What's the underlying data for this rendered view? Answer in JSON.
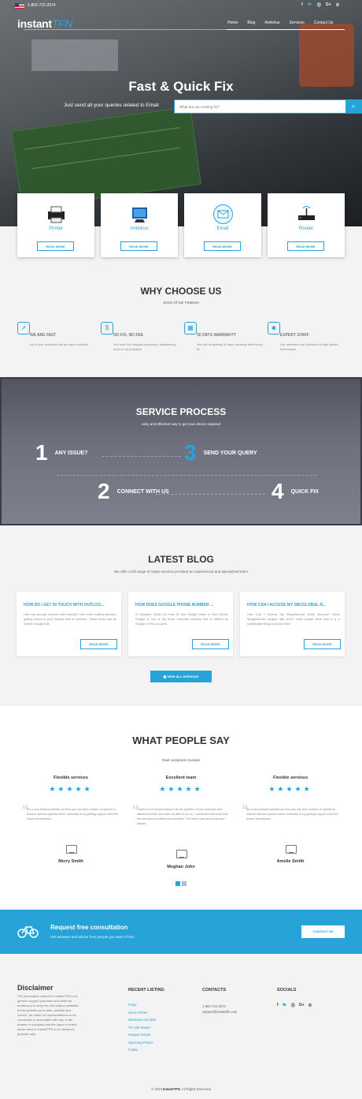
{
  "topbar": {
    "phone": "1-802-722-2574",
    "socials": [
      "f",
      "🐦",
      "⓪",
      "G+",
      "◎"
    ]
  },
  "header": {
    "logo_main": "instant",
    "logo_accent": "TFN",
    "nav": [
      "Home",
      "Blog",
      "Antivirus",
      "Services",
      "Contact Us"
    ]
  },
  "hero": {
    "title": "Fast & Quick Fix",
    "subtitle": "Just send all your queries related to Email",
    "search_placeholder": "What are you looking for?"
  },
  "services": [
    {
      "label": "Printer",
      "button": "READ MORE",
      "icon": "printer-icon"
    },
    {
      "label": "Antivirus",
      "button": "READ MORE",
      "icon": "antivirus-icon"
    },
    {
      "label": "Email",
      "button": "READ MORE",
      "icon": "email-icon"
    },
    {
      "label": "Router",
      "button": "READ MORE",
      "icon": "router-icon"
    }
  ],
  "why": {
    "title": "WHY CHOOSE US",
    "subtitle": "Some Of Our Features",
    "features": [
      {
        "title": "WE ARE FAST",
        "desc": "All of your problems will get quick solution",
        "icon": "rocket-icon"
      },
      {
        "title": "NO FIX, NO FEE",
        "desc": "You won't be charged anything if adiadanhog work is not provided",
        "icon": "dollar-icon"
      },
      {
        "title": "30 DAYS WARRANTY",
        "desc": "You will be getting 30 days warranty after every fix",
        "icon": "calendar-icon"
      },
      {
        "title": "EXPERT STAFF",
        "desc": "Our members are followed by high skilled technicians",
        "icon": "staff-icon"
      }
    ]
  },
  "process": {
    "title": "SERVICE PROCESS",
    "subtitle": "easy and effective way to get your device repaired",
    "steps": [
      {
        "num": "1",
        "label": "ANY ISSUE?"
      },
      {
        "num": "2",
        "label": "CONNECT WITH US"
      },
      {
        "num": "3",
        "label": "SEND YOUR QUERY"
      },
      {
        "num": "4",
        "label": "QUICK FIX"
      }
    ]
  },
  "blog": {
    "title": "LATEST BLOG",
    "subtitle": "We offer a full range of repair services provided an experienced and specialized team",
    "posts": [
      {
        "title": "HOW DO I GET IN TOUCH WITH OUTLOO...",
        "excerpt": "How can you get in touch with Outlook? Like other mailing services, getting issues in your Outlook mail is common. These errors can be severe enough that",
        "button": "READ MORE"
      },
      {
        "title": "HOW DOES GOOGLE PHONE NUMBER ...",
        "excerpt": "A Complete Guide On How To Use Google Voice in Your Device Google is one of the finest essential services that is offered by Google. It lets you send",
        "button": "READ MORE"
      },
      {
        "title": "HOW CAN I ACCESS MY SBCGLOBAL.N...",
        "excerpt": "How Can I Access My Sbcglobal.net Email Account? Since Sbcglobal.net merged with AT&T, most people think that it is a complicated thing to access their",
        "button": "READ MORE"
      }
    ],
    "view_all": "VIEW ALL SERVICES"
  },
  "testimonials": {
    "title": "WHAT PEOPLE SAY",
    "subtitle": "Real customers reviews",
    "items": [
      {
        "heading": "Flexible services",
        "stars": "★★★★★",
        "text": "It's a very helpful website as here you can find number of options to resolve various queries either manually or by getting support from the expert technicians.",
        "name": "Merry Smith"
      },
      {
        "heading": "Excellent team",
        "stars": "★★★★★",
        "text": "I spend a lot of time trying to fix the problem of my computer and attached printer and was not able to do so. I contacted this team and the services provided was excellent. The team was very polite and helpful",
        "name": "Meghan John"
      },
      {
        "heading": "Flexible services",
        "stars": "★★★★★",
        "text": "It's a very helpful website as here you can find number of options to resolve various queries either manually or by getting support from the expert technicians.",
        "name": "Amelie Smith"
      }
    ]
  },
  "cta": {
    "title": "Request free consultation",
    "subtitle": "Get answers and advice from people you want it from.",
    "button": "CONTACT US"
  },
  "footer": {
    "disclaimer_title": "Disclaimer",
    "disclaimer_text": "The information content in InstantTFN is for generic support purposes and while we endeavour to keep the information available in this website up to date, suitable and correct, we make no representations to be connected or associated with any of the brands or company and the logos or brand name used in InstantTFN is for reference purpose only.",
    "recent_title": "RECENT LISTING",
    "recent_links": [
      "FAQs",
      "Home Printer",
      "Windows Live Mail",
      "TP-Link Router",
      "Netgear Router",
      "Samsung Printer",
      "Fujitsu"
    ],
    "contacts_title": "CONTACTS",
    "contact_phone": "1-802-722-2574",
    "contact_email": "support@instanttfn.com",
    "socials_title": "SOCIALS",
    "socials": [
      "f",
      "🐦",
      "⓪",
      "G+",
      "◎"
    ],
    "copyright_pre": "© 2019 ",
    "copyright_brand": "InstantTFN",
    "copyright_post": ". All Rights Reserved"
  },
  "colors": {
    "accent": "#28a3d8",
    "dark": "#333333"
  }
}
